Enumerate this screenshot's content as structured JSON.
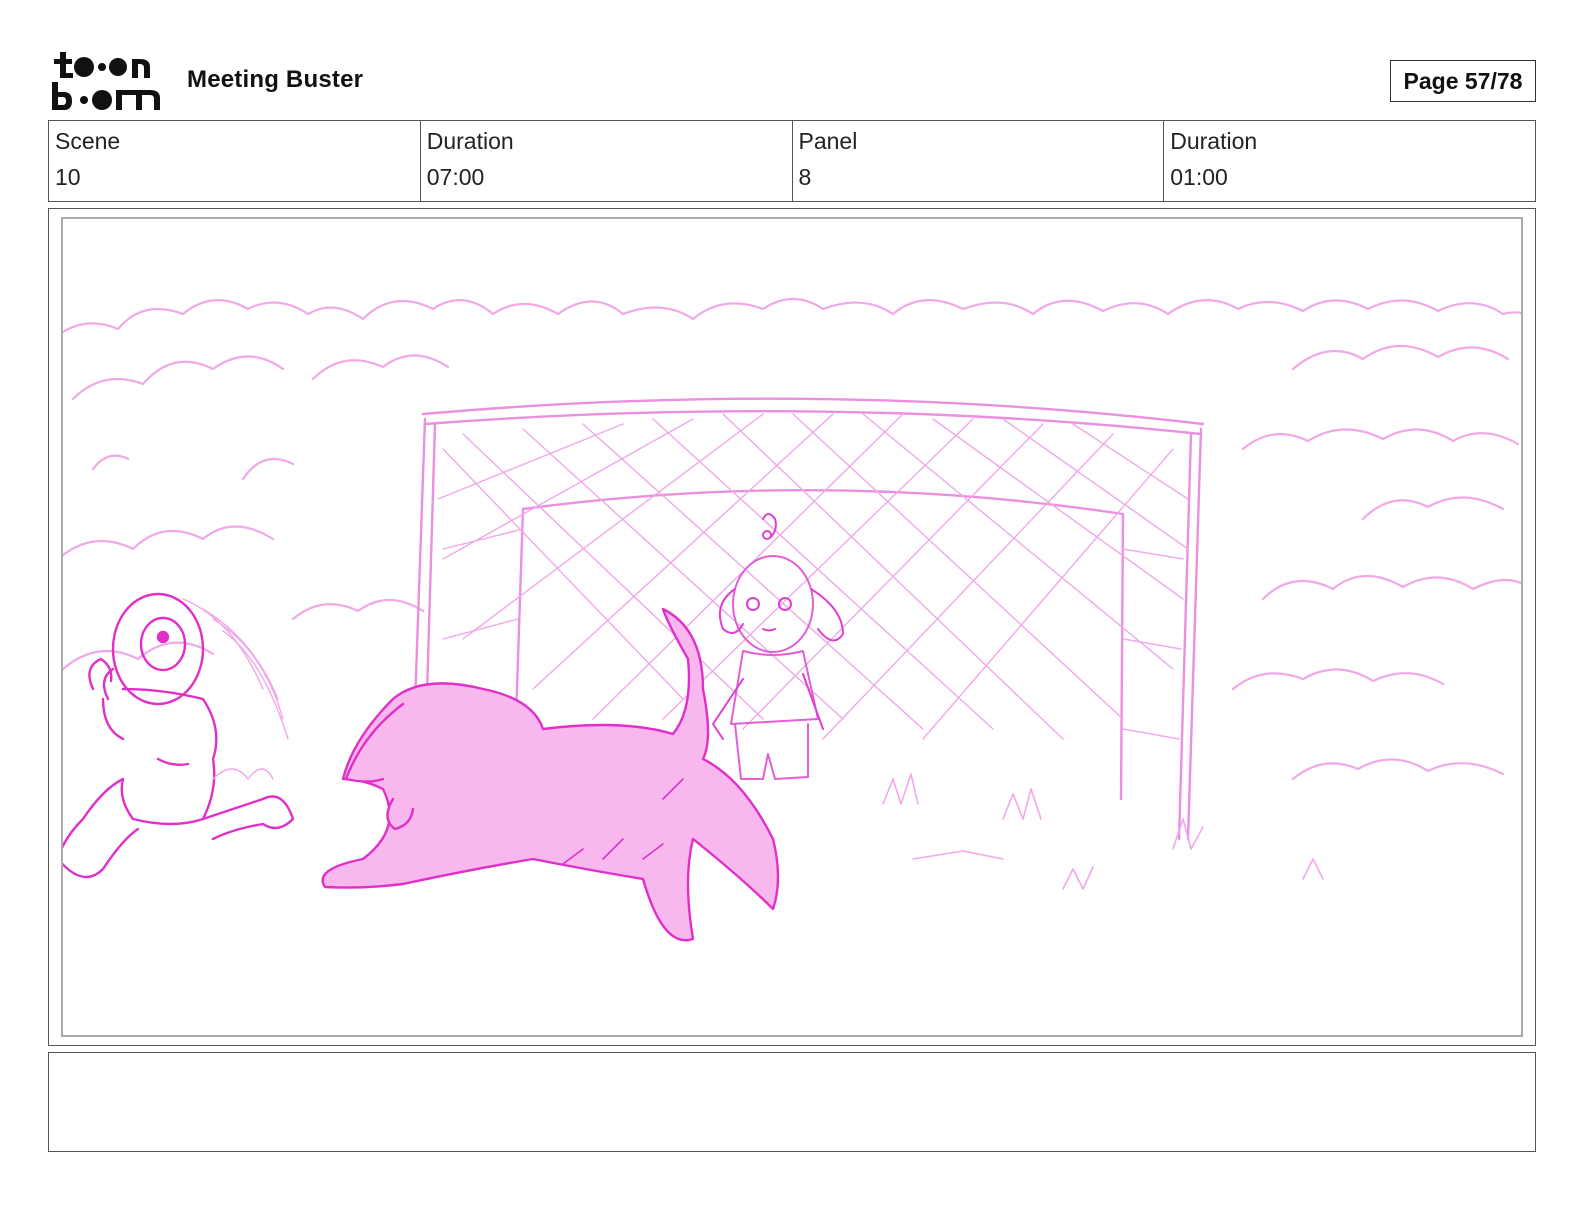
{
  "header": {
    "logo_text": "toon boom",
    "project_title": "Meeting Buster",
    "page_label": "Page 57/78"
  },
  "info": {
    "scene_label": "Scene",
    "scene_value": "10",
    "scene_duration_label": "Duration",
    "scene_duration_value": "07:00",
    "panel_label": "Panel",
    "panel_value": "8",
    "panel_duration_label": "Duration",
    "panel_duration_value": "01:00"
  },
  "panel": {
    "sketch_color": "#e030c8",
    "sketch_light_color": "#f0a0e8",
    "fill_color": "#f8b8ee"
  },
  "notes": {
    "text": ""
  }
}
